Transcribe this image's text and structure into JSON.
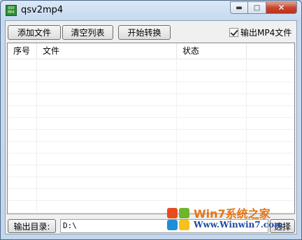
{
  "window": {
    "title": "qsv2mp4",
    "icon_text": "QSV MP4",
    "controls": {
      "minimize": "▬",
      "maximize": "□",
      "close": "✕"
    }
  },
  "toolbar": {
    "add_files_label": "添加文件",
    "clear_list_label": "清空列表",
    "start_convert_label": "开始转换",
    "output_mp4_label": "输出MP4文件",
    "output_mp4_checked": true
  },
  "list": {
    "columns": [
      "序号",
      "文件",
      "状态",
      ""
    ],
    "rows": []
  },
  "footer": {
    "output_dir_label": "输出目录:",
    "output_dir_value": "D:\\",
    "browse_label": "选择"
  },
  "watermark": {
    "title": "Win7系统之家",
    "url": "Www.Winwin7.com",
    "colors": [
      "#e84c1e",
      "#6fb52c",
      "#1f8ed8",
      "#f7c01d"
    ]
  }
}
